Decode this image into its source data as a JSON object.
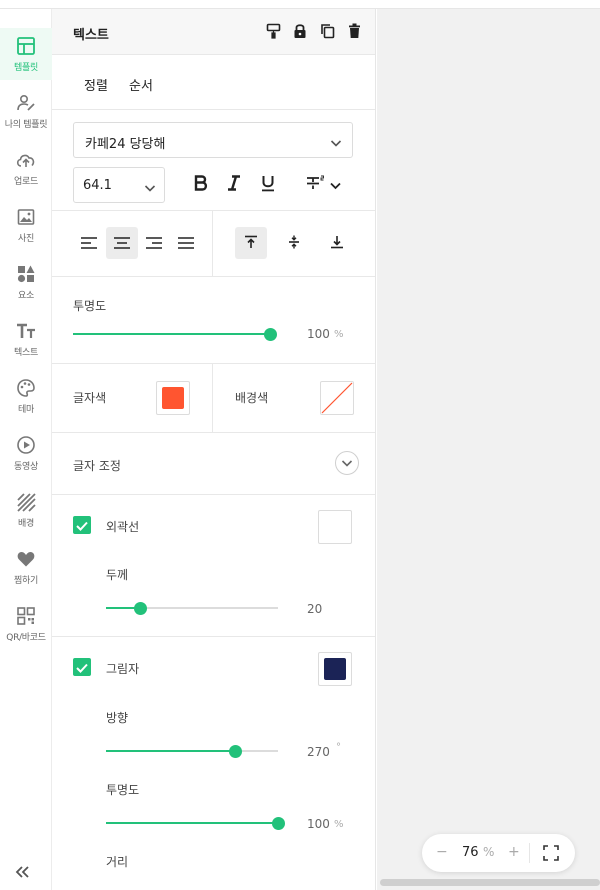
{
  "colors": {
    "accent": "#22c17a",
    "text_color": "#ff5530",
    "shadow_color": "#1b2356"
  },
  "rail": {
    "items": [
      {
        "label": "템플릿",
        "icon": "layout-icon"
      },
      {
        "label": "나의 템플릿",
        "icon": "user-edit-icon"
      },
      {
        "label": "업로드",
        "icon": "cloud-upload-icon"
      },
      {
        "label": "사진",
        "icon": "image-icon"
      },
      {
        "label": "요소",
        "icon": "shapes-icon"
      },
      {
        "label": "텍스트",
        "icon": "text-icon"
      },
      {
        "label": "테마",
        "icon": "palette-icon"
      },
      {
        "label": "동영상",
        "icon": "play-icon"
      },
      {
        "label": "배경",
        "icon": "background-icon"
      },
      {
        "label": "찜하기",
        "icon": "heart-icon"
      },
      {
        "label": "QR/바코드",
        "icon": "qr-icon"
      }
    ]
  },
  "panel": {
    "title": "텍스트",
    "tabs": [
      "정렬",
      "순서"
    ],
    "font": {
      "family": "카페24 당당해",
      "size": "64.1"
    },
    "opacity": {
      "label": "투명도",
      "value": "100",
      "unit": "%",
      "level": 100
    },
    "text_color_label": "글자색",
    "bg_color_label": "배경색",
    "adjust_label": "글자 조정",
    "outline": {
      "label": "외곽선",
      "thickness_label": "두께",
      "thickness": "20",
      "thickness_level": 20
    },
    "shadow": {
      "label": "그림자",
      "direction_label": "방향",
      "direction": "270",
      "direction_unit": "°",
      "direction_level": 75,
      "opacity_label": "투명도",
      "opacity": "100",
      "opacity_unit": "%",
      "opacity_level": 100,
      "distance_label": "거리"
    }
  },
  "zoom": {
    "minus": "−",
    "value": "76",
    "unit": "%",
    "plus": "+"
  }
}
